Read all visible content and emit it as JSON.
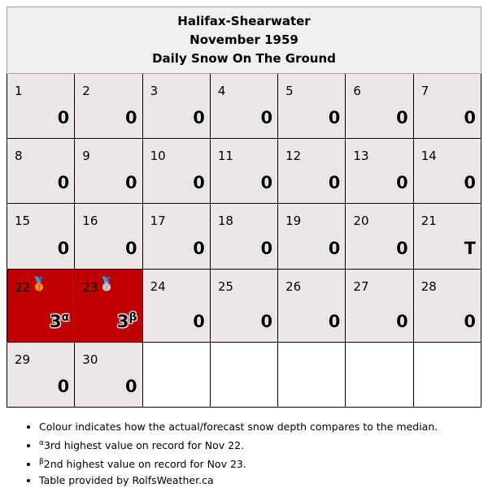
{
  "title": {
    "station": "Halifax-Shearwater",
    "month": "November 1959",
    "subtitle": "Daily Snow On The Ground"
  },
  "weeks": [
    [
      {
        "day": "1",
        "value": "0"
      },
      {
        "day": "2",
        "value": "0"
      },
      {
        "day": "3",
        "value": "0"
      },
      {
        "day": "4",
        "value": "0"
      },
      {
        "day": "5",
        "value": "0"
      },
      {
        "day": "6",
        "value": "0"
      },
      {
        "day": "7",
        "value": "0"
      }
    ],
    [
      {
        "day": "8",
        "value": "0"
      },
      {
        "day": "9",
        "value": "0"
      },
      {
        "day": "10",
        "value": "0"
      },
      {
        "day": "11",
        "value": "0"
      },
      {
        "day": "12",
        "value": "0"
      },
      {
        "day": "13",
        "value": "0"
      },
      {
        "day": "14",
        "value": "0"
      }
    ],
    [
      {
        "day": "15",
        "value": "0"
      },
      {
        "day": "16",
        "value": "0"
      },
      {
        "day": "17",
        "value": "0"
      },
      {
        "day": "18",
        "value": "0"
      },
      {
        "day": "19",
        "value": "0"
      },
      {
        "day": "20",
        "value": "0"
      },
      {
        "day": "21",
        "value": "T"
      }
    ],
    [
      {
        "day": "22",
        "value": "3",
        "note": "α",
        "medal": "🥉",
        "highlight": true
      },
      {
        "day": "23",
        "value": "3",
        "note": "β",
        "medal": "🥈",
        "highlight": true
      },
      {
        "day": "24",
        "value": "0"
      },
      {
        "day": "25",
        "value": "0"
      },
      {
        "day": "26",
        "value": "0"
      },
      {
        "day": "27",
        "value": "0"
      },
      {
        "day": "28",
        "value": "0"
      }
    ],
    [
      {
        "day": "29",
        "value": "0"
      },
      {
        "day": "30",
        "value": "0"
      },
      null,
      null,
      null,
      null,
      null
    ]
  ],
  "colors": {
    "highlight": "#c00000",
    "cell": "#ece6e6",
    "header": "#f0f0f0"
  },
  "notes": [
    {
      "sup": "",
      "text": "Colour indicates how the actual/forecast snow depth compares to the median."
    },
    {
      "sup": "α",
      "text": "3rd highest value on record for Nov 22."
    },
    {
      "sup": "β",
      "text": "2nd highest value on record for Nov 23."
    },
    {
      "sup": "",
      "text": "Table provided by RolfsWeather.ca"
    }
  ]
}
